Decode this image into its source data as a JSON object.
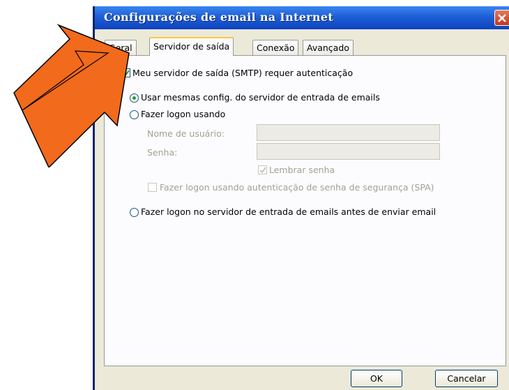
{
  "window": {
    "title": "Configurações de email na Internet",
    "close_icon": "close-icon"
  },
  "tabs": [
    {
      "label": "Geral",
      "active": false
    },
    {
      "label": "Servidor de saída",
      "active": true
    },
    {
      "label": "Conexão",
      "active": false
    },
    {
      "label": "Avançado",
      "active": false
    }
  ],
  "outgoing": {
    "smtp_auth": {
      "label": "Meu servidor de saída (SMTP) requer autenticação",
      "checked": true
    },
    "options": [
      {
        "label": "Usar mesmas config. do servidor de entrada de emails",
        "selected": true
      },
      {
        "label": "Fazer logon usando",
        "selected": false
      }
    ],
    "username": {
      "label": "Nome de usuário:",
      "value": ""
    },
    "password": {
      "label": "Senha:",
      "value": ""
    },
    "remember_password": {
      "label": "Lembrar senha",
      "checked": true
    },
    "spa": {
      "label": "Fazer logon usando autenticação de senha de segurança (SPA)",
      "checked": false
    },
    "logon_before_send": {
      "label": "Fazer logon no servidor de entrada de emails antes de enviar email",
      "selected": false
    }
  },
  "buttons": {
    "ok": "OK",
    "cancel": "Cancelar"
  },
  "colors": {
    "accent_arrow": "#f26a1b",
    "titlebar": "#1f5fd6",
    "dialog_bg": "#ece9d8"
  }
}
